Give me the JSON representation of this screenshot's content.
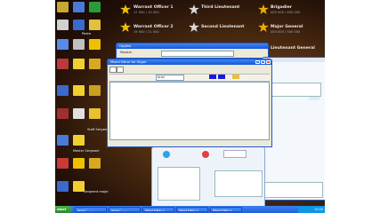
{
  "ranks": [
    {
      "name": "Warrant Officer 1",
      "points": "17 000 / 19 000"
    },
    {
      "name": "Third Lieutenant",
      "points": "..."
    },
    {
      "name": "Brigadier",
      "points": "400 000 / 450 000"
    },
    {
      "name": "Warrant Officer 2",
      "points": "19 000 / 21 000"
    },
    {
      "name": "Second Lieutenant",
      "points": "..."
    },
    {
      "name": "Major General",
      "points": "450 000 / 500 000"
    },
    {
      "name": "Lieutenant General",
      "points": "..."
    }
  ],
  "desktop_icons": [
    {
      "label": "Pedro"
    },
    {
      "label": "Staff Sergeant"
    },
    {
      "label": "Master Sergeant"
    },
    {
      "label": "Sergeant major"
    },
    {
      "label": "Sergeant"
    },
    {
      "label": "Sergeant"
    }
  ],
  "windows": {
    "back_title": "Opções",
    "front_title": "Mixed Editor for Skype",
    "front_field": "Mostrar",
    "font_label": "Arial"
  },
  "taskbar": {
    "start_label": "start",
    "buttons": [
      "Skype™ - ...",
      "Skype™ - ...",
      "Mixed Editor f...",
      "Mixed Editor f...",
      "Mixed Editor f..."
    ],
    "clock": "10:30"
  },
  "colors": {
    "accent": "#2058c8",
    "taskbar": "#235ed8",
    "start": "#2b8a2b"
  }
}
